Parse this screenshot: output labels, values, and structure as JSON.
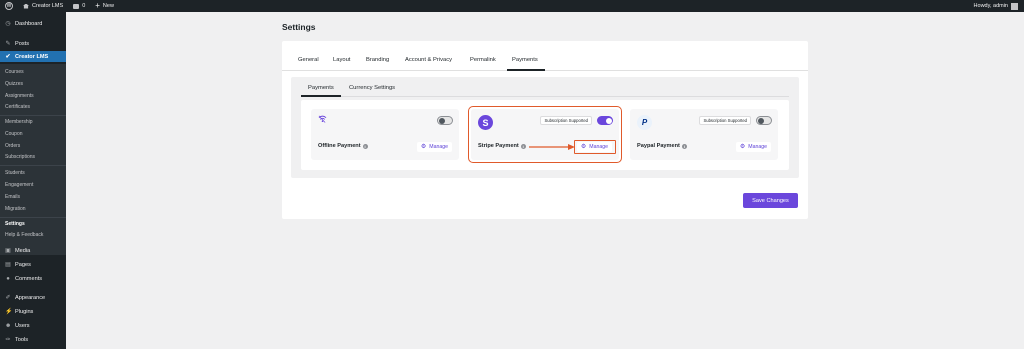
{
  "adminbar": {
    "site_name": "Creator LMS",
    "comments_count": "0",
    "new_label": "New",
    "howdy": "Howdy, admin"
  },
  "sidebar": {
    "dashboard": "Dashboard",
    "posts": "Posts",
    "creator_lms": "Creator LMS",
    "sub": {
      "courses": "Courses",
      "quizzes": "Quizzes",
      "assignments": "Assignments",
      "certificates": "Certificates",
      "membership": "Membership",
      "coupon": "Coupon",
      "orders": "Orders",
      "subscriptions": "Subscriptions",
      "students": "Students",
      "engagement": "Engagement",
      "emails": "Emails",
      "migration": "Migration",
      "settings": "Settings",
      "help": "Help & Feedback"
    },
    "media": "Media",
    "pages": "Pages",
    "comments": "Comments",
    "appearance": "Appearance",
    "plugins": "Plugins",
    "users": "Users",
    "tools": "Tools"
  },
  "page": {
    "title": "Settings",
    "tabs": [
      "General",
      "Layout",
      "Branding",
      "Account & Privacy",
      "Permalink",
      "Payments"
    ],
    "subtabs": [
      "Payments",
      "Currency Settings"
    ],
    "save_label": "Save Changes"
  },
  "cards": {
    "offline": {
      "name": "Offline Payment",
      "manage": "Manage",
      "enabled": false
    },
    "stripe": {
      "name": "Stripe Payment",
      "manage": "Manage",
      "badge": "Subscription Supported",
      "enabled": true
    },
    "paypal": {
      "name": "Paypal Payment",
      "manage": "Manage",
      "badge": "Subscription Supported",
      "enabled": false
    }
  },
  "colors": {
    "accent": "#6b47dc",
    "highlight": "#e05a2b",
    "sidebar": "#1d2327",
    "active_menu": "#2271b1"
  },
  "icons": {
    "offline": "wifi-icon",
    "stripe": "stripe-logo-icon",
    "paypal": "paypal-logo-icon",
    "manage": "gear-icon"
  }
}
